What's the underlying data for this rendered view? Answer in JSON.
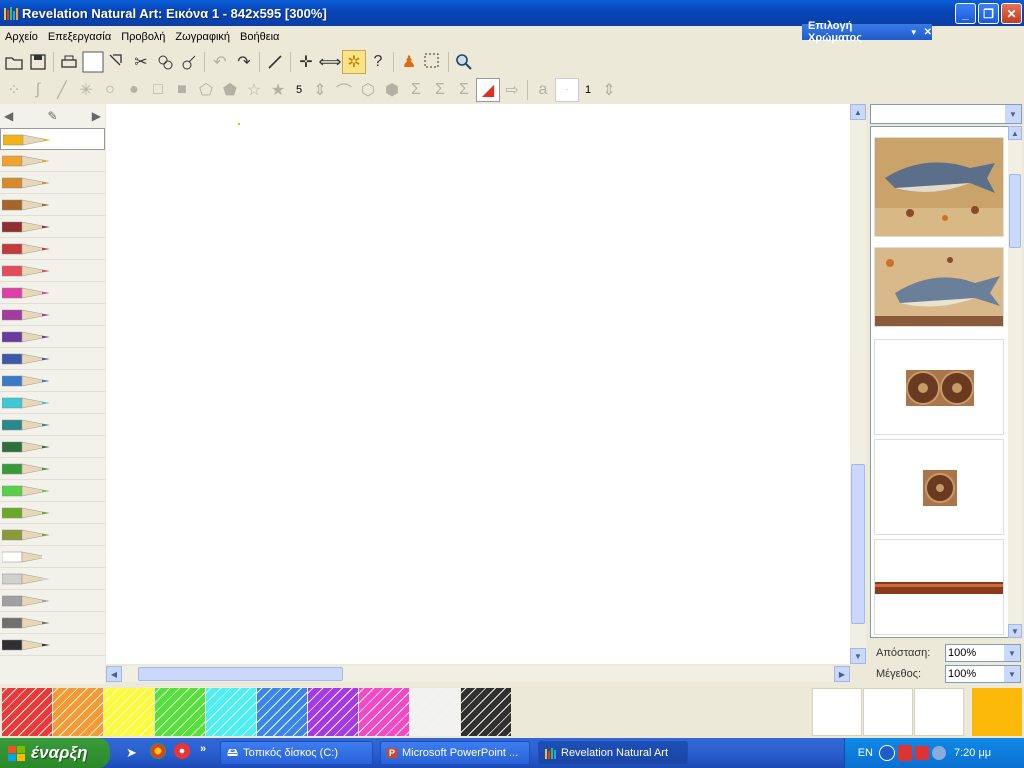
{
  "window": {
    "title": "Revelation Natural Art: Εικόνα 1 - 842x595 [300%]",
    "minimize": "_",
    "restore": "❐",
    "close": "✕"
  },
  "menu": [
    "Αρχείο",
    "Επεξεργασία",
    "Προβολή",
    "Ζωγραφική",
    "Βοήθεια"
  ],
  "color_picker_tab": {
    "label": "Επιλογή Χρώματος",
    "arrow": "▼",
    "close": "✕"
  },
  "toolbar2": {
    "sides_value": "5",
    "size_value": "1"
  },
  "pencil_colors": [
    "#f2b414",
    "#f0a22e",
    "#d78a2c",
    "#a7652a",
    "#8f2f2f",
    "#c43a3a",
    "#e64b5a",
    "#e03fa8",
    "#a33b9e",
    "#6a3aa0",
    "#3c5aa8",
    "#3a7bc8",
    "#3cc8d6",
    "#2a8a8a",
    "#2f6f3a",
    "#3a9a3a",
    "#5ad04a",
    "#6aa82a",
    "#8a9a3a",
    "#ffffff",
    "#d0d0d0",
    "#a0a0a0",
    "#707070",
    "#303030"
  ],
  "right_panel": {
    "distance_label": "Απόσταση:",
    "distance_value": "100%",
    "size_label": "Μέγεθος:",
    "size_value": "100%"
  },
  "palette_colors": [
    "#e83a3a",
    "#f59a32",
    "#fbfb3a",
    "#52e23a",
    "#4af0f4",
    "#3a86e6",
    "#a33ae6",
    "#f04ac8",
    "#f2f2f2",
    "#303030"
  ],
  "selected_color": "#fdb90a",
  "taskbar": {
    "start_label": "έναρξη",
    "tasks": [
      "Τοπικός δίσκος (C:)",
      "Microsoft PowerPoint ...",
      "Revelation Natural Art"
    ],
    "language": "EN",
    "clock": "7:20 μμ"
  }
}
